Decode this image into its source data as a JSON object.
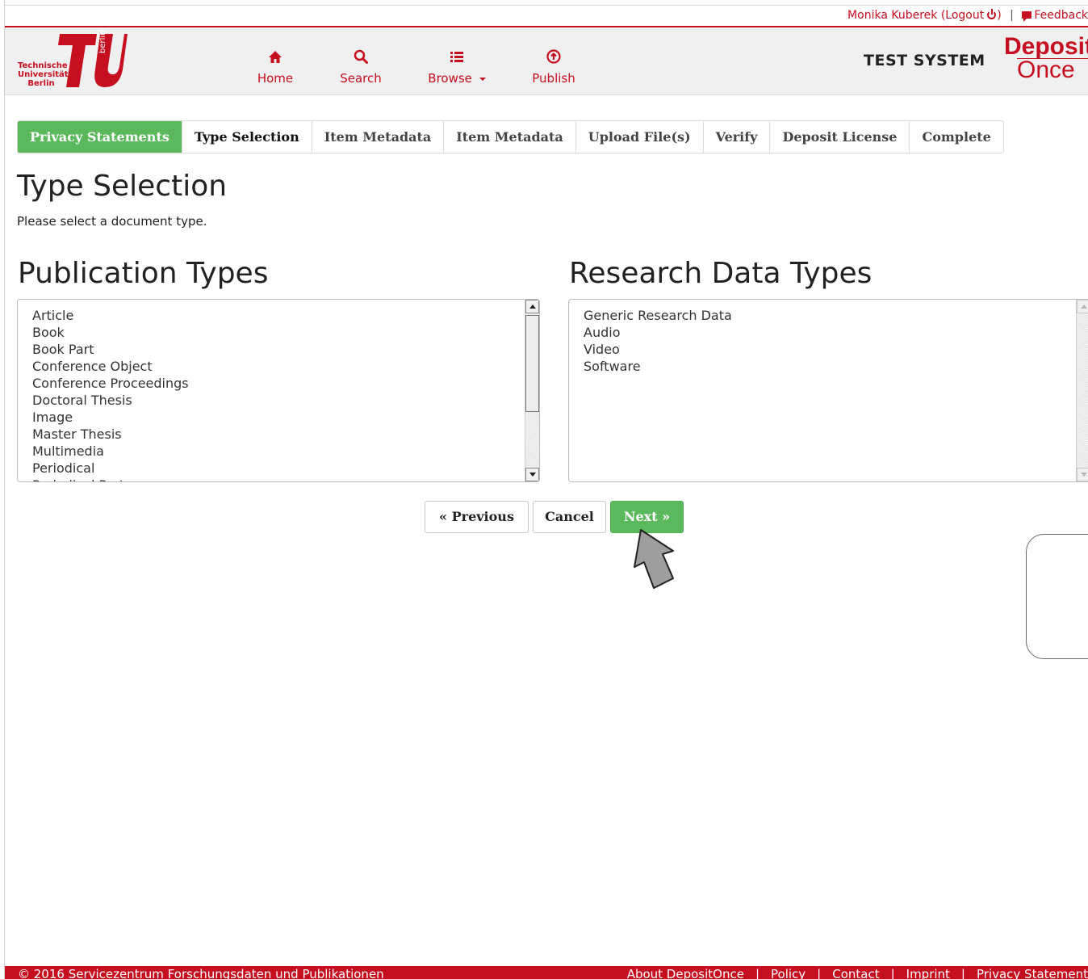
{
  "topbar": {
    "user": "Monika Kuberek",
    "logout_open": "(Logout",
    "logout_close": ")",
    "separator": "|",
    "feedback": "Feedback"
  },
  "header": {
    "logo_text_1": "Technische",
    "logo_text_2": "Universität",
    "logo_text_3": "Berlin",
    "logo_vertical": "berlin",
    "nav": [
      {
        "label": "Home",
        "icon": "home-icon"
      },
      {
        "label": "Search",
        "icon": "search-icon"
      },
      {
        "label": "Browse",
        "icon": "list-icon"
      },
      {
        "label": "Publish",
        "icon": "upload-circle-icon"
      }
    ],
    "test_system": "TEST SYSTEM",
    "brand_top": "Deposit",
    "brand_bottom": "Once"
  },
  "steps": [
    {
      "label": "Privacy Statements",
      "state": "done"
    },
    {
      "label": "Type Selection",
      "state": "current"
    },
    {
      "label": "Item Metadata",
      "state": "todo"
    },
    {
      "label": "Item Metadata",
      "state": "todo"
    },
    {
      "label": "Upload File(s)",
      "state": "todo"
    },
    {
      "label": "Verify",
      "state": "todo"
    },
    {
      "label": "Deposit License",
      "state": "todo"
    },
    {
      "label": "Complete",
      "state": "todo"
    }
  ],
  "page": {
    "title": "Type Selection",
    "instructions": "Please select a document type."
  },
  "publication": {
    "title": "Publication Types",
    "items": [
      "Article",
      "Book",
      "Book Part",
      "Conference Object",
      "Conference Proceedings",
      "Doctoral Thesis",
      "Image",
      "Master Thesis",
      "Multimedia",
      "Periodical",
      "Periodical Part"
    ]
  },
  "research": {
    "title": "Research Data Types",
    "items": [
      "Generic Research Data",
      "Audio",
      "Video",
      "Software"
    ]
  },
  "buttons": {
    "previous": "« Previous",
    "cancel": "Cancel",
    "next": "Next »"
  },
  "footer": {
    "copyright": "© 2016 Servicezentrum Forschungsdaten und Publikationen",
    "links": [
      "About DepositOnce",
      "Policy",
      "Contact",
      "Imprint",
      "Privacy Statement"
    ],
    "separator": "|"
  },
  "colors": {
    "brand_red": "#c50e1f",
    "success_green": "#5cb85c"
  }
}
